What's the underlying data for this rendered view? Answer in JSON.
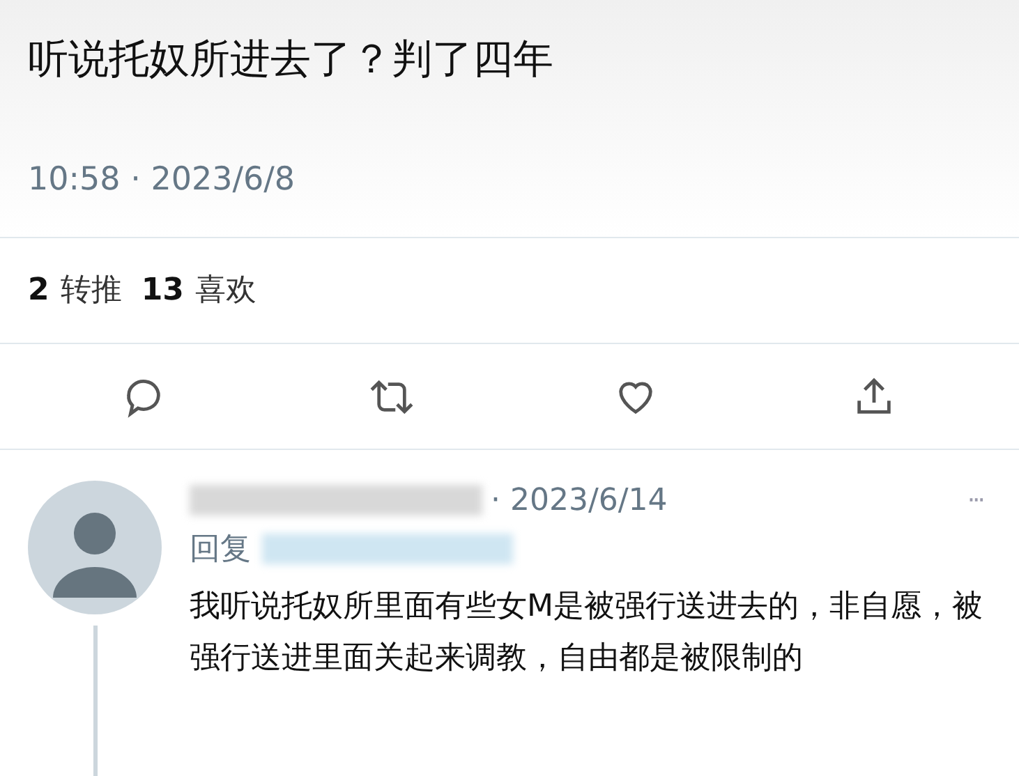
{
  "tweet": {
    "text": "听说托奴所进去了？判了四年",
    "time": "10:58 · 2023/6/8",
    "stats": [
      {
        "count": "2",
        "label": "转推"
      },
      {
        "count": "13",
        "label": "喜欢"
      }
    ]
  },
  "reply": {
    "date": "· 2023/6/14",
    "more": "···",
    "reply_to": "回复",
    "text": "我听说托奴所里面有些女M是被强行送进去的，非自愿，被强行送进里面关起来调教，自由都是被限制的"
  }
}
